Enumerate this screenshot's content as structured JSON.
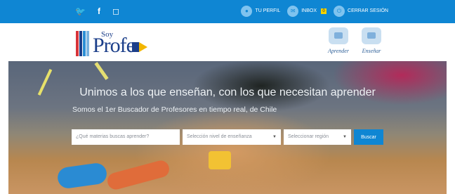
{
  "topbar": {
    "social": [
      {
        "icon": "twitter-icon",
        "glyph": "🐦"
      },
      {
        "icon": "facebook-icon",
        "glyph": "f"
      },
      {
        "icon": "instagram-icon",
        "glyph": "◻"
      }
    ],
    "user_nav": [
      {
        "icon": "user-icon",
        "label": "TU PERFIL"
      },
      {
        "icon": "inbox-icon",
        "label": "INBOX",
        "badge": "0"
      },
      {
        "icon": "logout-icon",
        "label": "CERRAR SESIÓN"
      }
    ]
  },
  "header": {
    "logo": {
      "soy": "Soy",
      "profe": "Profe"
    },
    "links": [
      {
        "icon": "learn-icon",
        "label": "Aprender"
      },
      {
        "icon": "teach-icon",
        "label": "Enseñar"
      }
    ]
  },
  "hero": {
    "title": "Unimos a los que enseñan, con los que necesitan aprender",
    "subtitle": "Somos el 1er Buscador de Profesores en tiempo real, de Chile",
    "search": {
      "subject_placeholder": "¿Qué materias buscas aprender?",
      "level_value": "Selección nivel de enseñanza",
      "region_value": "Seleccionar región",
      "button_label": "Buscar"
    }
  },
  "colors": {
    "accent": "#0f86d3",
    "brand": "#1c3f8a",
    "pencil": "#f2b600"
  }
}
